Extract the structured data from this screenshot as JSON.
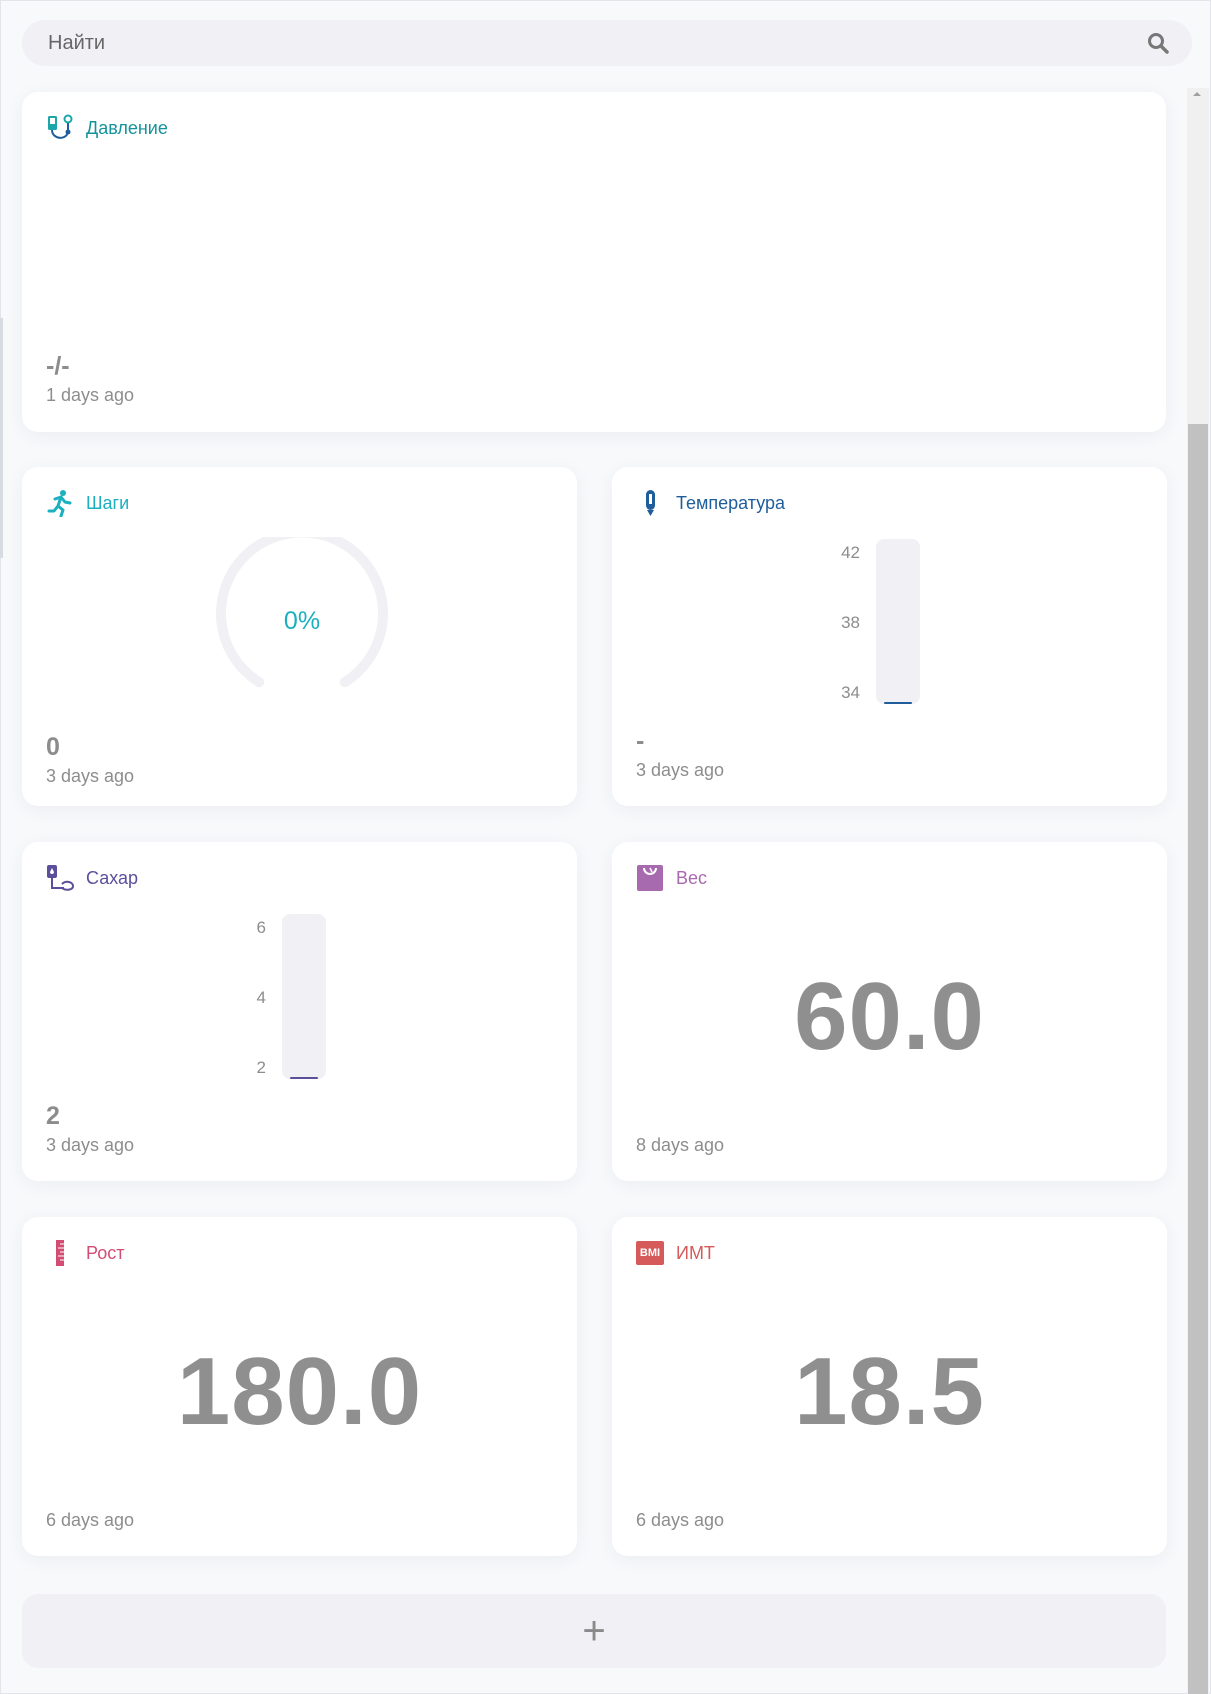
{
  "search": {
    "placeholder": "Найти"
  },
  "cards": {
    "pressure": {
      "title": "Давление",
      "value": "-/-",
      "updated": "1 days ago",
      "color": "#13939b"
    },
    "steps": {
      "title": "Шаги",
      "percent_label": "0%",
      "progress": 0,
      "value": "0",
      "updated": "3 days ago",
      "color": "#1ab0c0"
    },
    "temperature": {
      "title": "Температура",
      "ticks": [
        "42",
        "38",
        "34"
      ],
      "value": "-",
      "updated": "3 days ago",
      "color": "#1f5e9b"
    },
    "sugar": {
      "title": "Сахар",
      "ticks": [
        "6",
        "4",
        "2"
      ],
      "value": "2",
      "updated": "3 days ago",
      "color": "#5b4f9c"
    },
    "weight": {
      "title": "Вес",
      "value": "60.0",
      "updated": "8 days ago",
      "color": "#a86aae"
    },
    "height": {
      "title": "Рост",
      "value": "180.0",
      "updated": "6 days ago",
      "color": "#d24c73"
    },
    "bmi": {
      "title": "ИМТ",
      "icon_text": "BMI",
      "value": "18.5",
      "updated": "6 days ago",
      "color": "#d65a5a"
    }
  },
  "add_button": {
    "label": "+"
  }
}
